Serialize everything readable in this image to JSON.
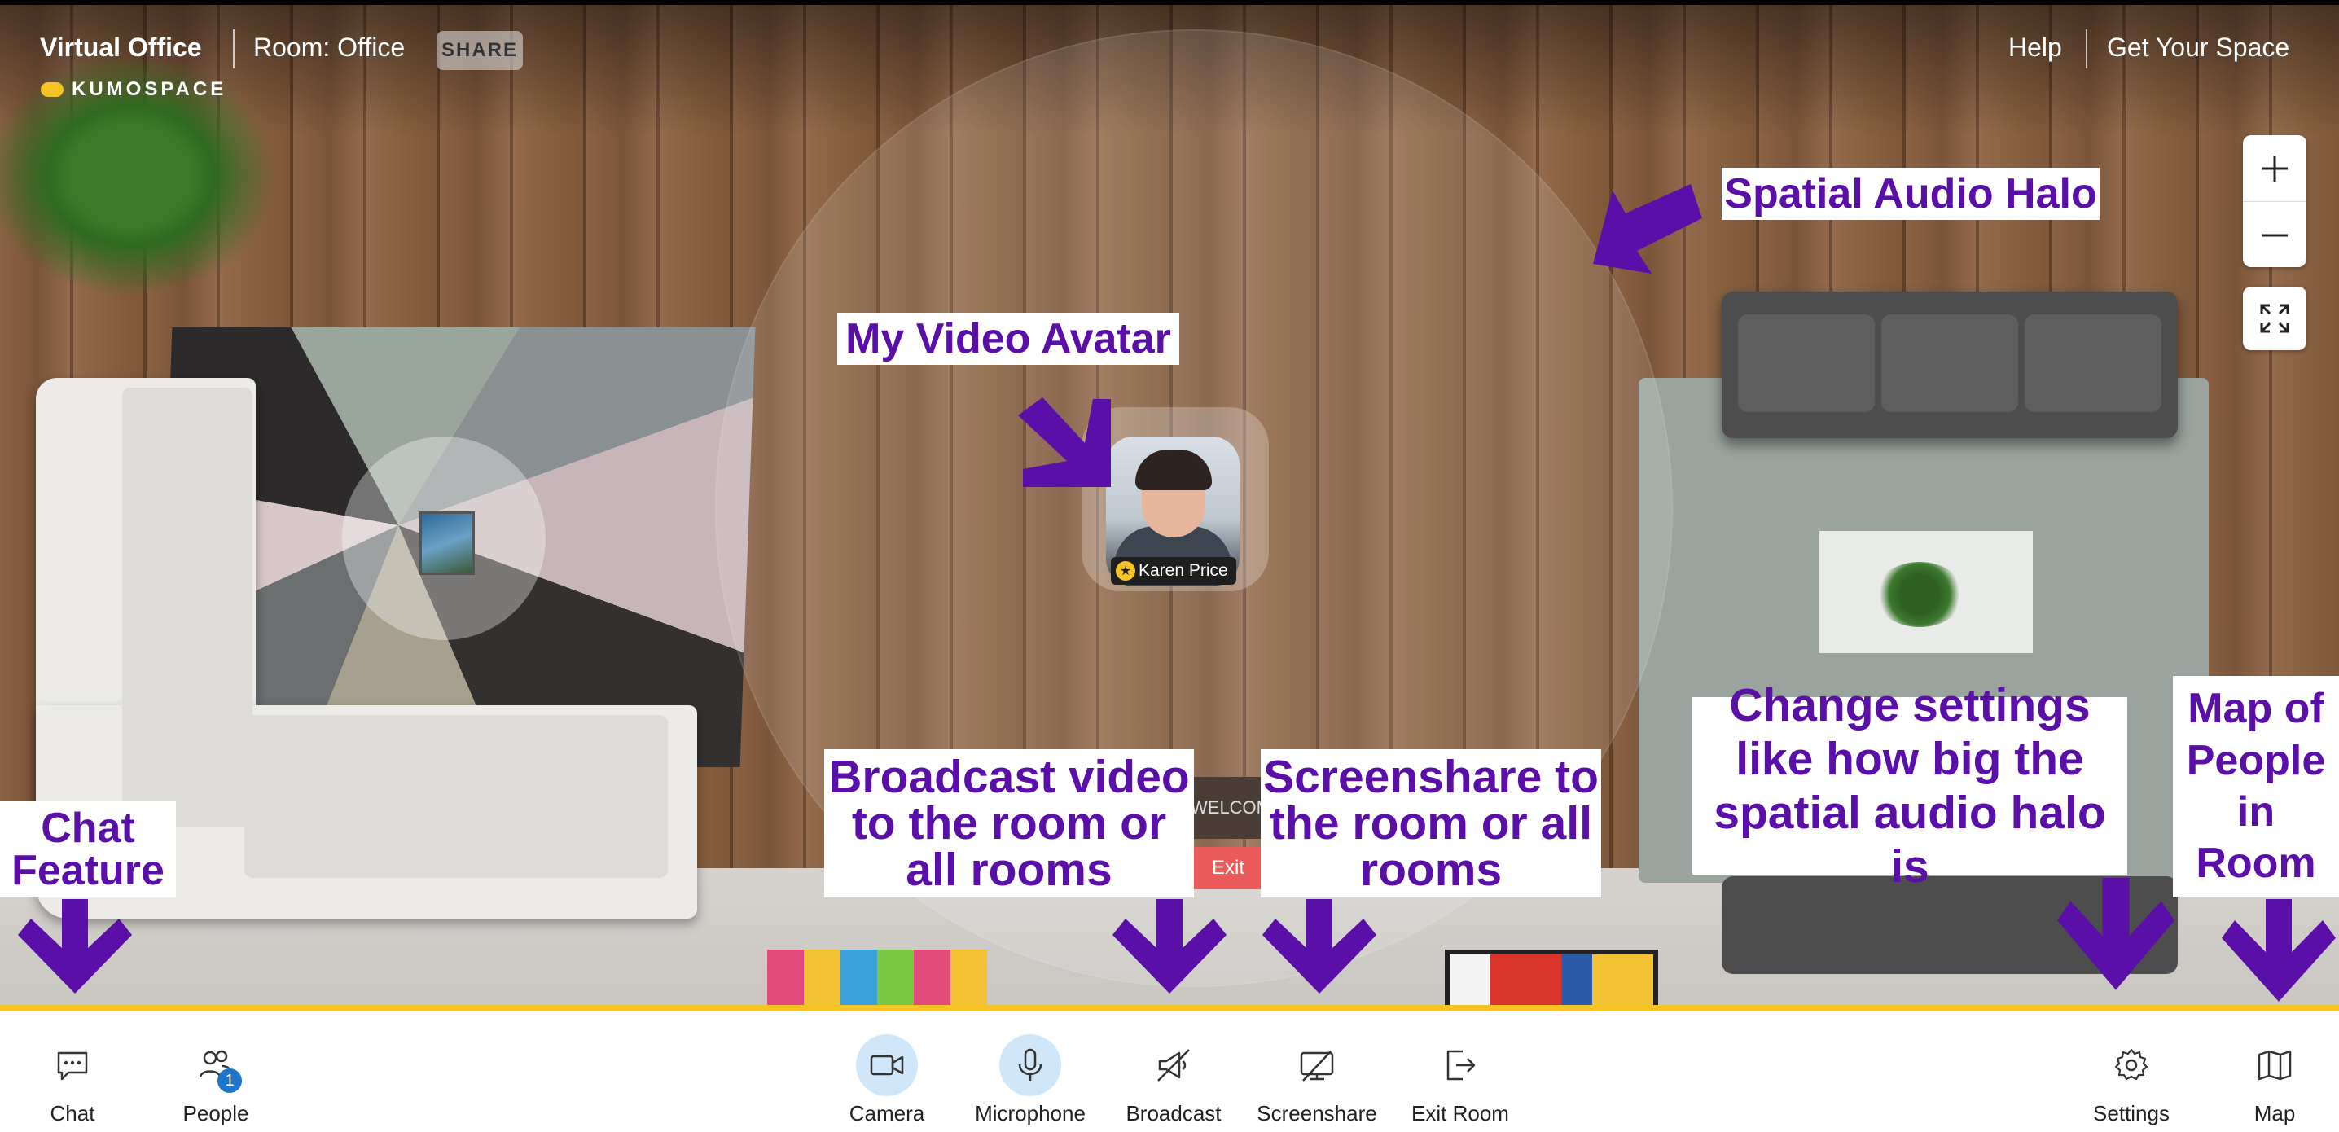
{
  "header": {
    "app_title": "Virtual Office",
    "room_label": "Room: Office",
    "share_label": "SHARE",
    "brand": "KUMOSPACE",
    "help_label": "Help",
    "get_space_label": "Get Your Space"
  },
  "scene": {
    "welcome_mat": "WELCOME",
    "exit_label": "Exit"
  },
  "avatar": {
    "name": "Karen Price"
  },
  "callouts": {
    "halo": "Spatial Audio Halo",
    "my_video": "My Video Avatar",
    "broadcast": "Broadcast video\nto the room or\nall rooms",
    "screenshare": "Screenshare to\nthe room or all\nrooms",
    "settings": "Change settings\nlike how big the\nspatial audio halo is",
    "chat": "Chat\nFeature",
    "map": "Map of\nPeople\nin\nRoom"
  },
  "toolbar": {
    "chat": "Chat",
    "people": "People",
    "people_count": "1",
    "camera": "Camera",
    "microphone": "Microphone",
    "broadcast": "Broadcast",
    "screenshare": "Screenshare",
    "exit_room": "Exit Room",
    "settings": "Settings",
    "map": "Map"
  },
  "icons": {
    "zoom_in": "plus-icon",
    "zoom_out": "minus-icon",
    "fullscreen": "expand-icon",
    "chat": "chat-bubble-icon",
    "people": "people-icon",
    "camera": "video-camera-icon",
    "microphone": "microphone-icon",
    "broadcast": "broadcast-off-icon",
    "screenshare": "screenshare-off-icon",
    "exit_room": "exit-door-icon",
    "settings": "gear-icon",
    "map": "map-icon"
  },
  "colors": {
    "accent_yellow": "#f6c324",
    "annotation_purple": "#5a10a8",
    "active_button": "#cfe7f8",
    "badge_blue": "#1e74c9",
    "exit_red": "#ec5b5b"
  }
}
